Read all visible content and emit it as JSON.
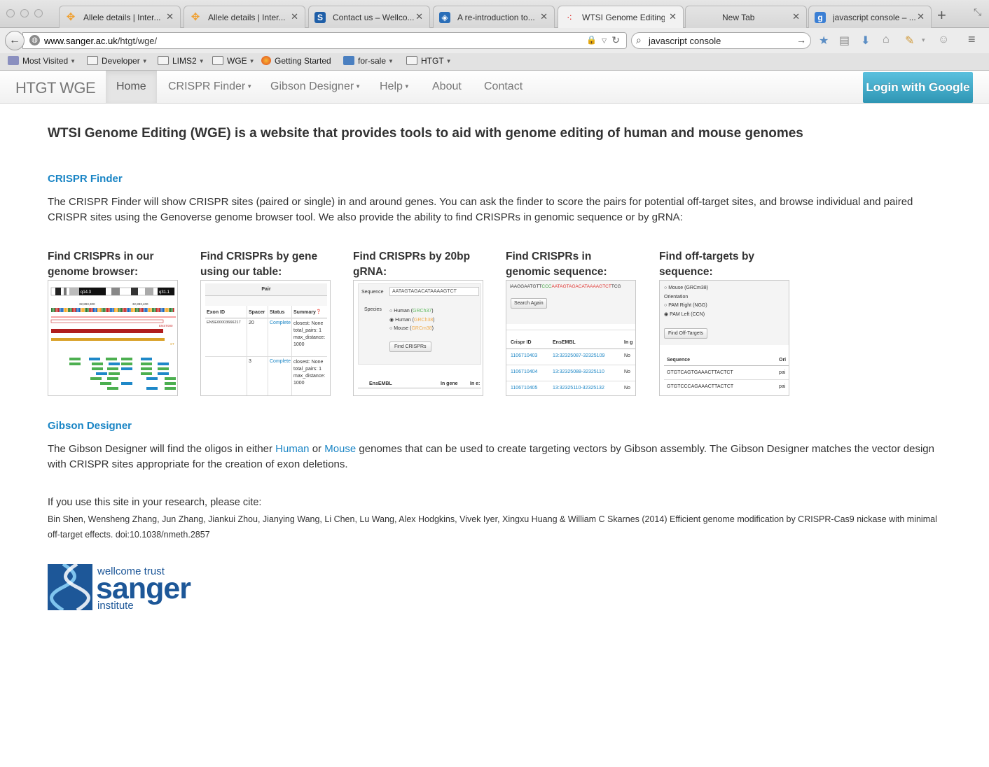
{
  "browser": {
    "tabs": [
      {
        "title": "Allele details | Inter...",
        "icon": "allele-icon",
        "color": "#f0a030"
      },
      {
        "title": "Allele details | Inter...",
        "icon": "allele-icon",
        "color": "#f0a030"
      },
      {
        "title": "Contact us – Wellco...",
        "icon": "wellcome-icon",
        "color": "#1f5fa8"
      },
      {
        "title": "A re-introduction to...",
        "icon": "mdn-icon",
        "color": "#2a6eb8"
      },
      {
        "title": "WTSI Genome Editing",
        "icon": "wge-icon",
        "color": "#e0332f",
        "active": true
      },
      {
        "title": "New Tab",
        "icon": "",
        "color": ""
      },
      {
        "title": "javascript console – ...",
        "icon": "google-icon",
        "color": "#3b7fd4"
      }
    ],
    "url": {
      "domain": "www.sanger.ac.uk",
      "path": "/htgt/wge/"
    },
    "search_value": "javascript console",
    "bookmarks": [
      {
        "label": "Most Visited",
        "dropdown": true
      },
      {
        "label": "Developer",
        "dropdown": true
      },
      {
        "label": "LIMS2",
        "dropdown": true
      },
      {
        "label": "WGE",
        "dropdown": true
      },
      {
        "label": "Getting Started",
        "dropdown": false
      },
      {
        "label": "for-sale",
        "dropdown": true
      },
      {
        "label": "HTGT",
        "dropdown": true
      }
    ]
  },
  "site": {
    "brand": "HTGT WGE",
    "nav": [
      {
        "label": "Home",
        "active": true,
        "dropdown": false
      },
      {
        "label": "CRISPR Finder",
        "dropdown": true
      },
      {
        "label": "Gibson Designer",
        "dropdown": true
      },
      {
        "label": "Help",
        "dropdown": true
      },
      {
        "label": "About",
        "dropdown": false
      },
      {
        "label": "Contact",
        "dropdown": false
      }
    ],
    "login_label": "Login with Google"
  },
  "content": {
    "headline": "WTSI Genome Editing (WGE) is a website that provides tools to aid with genome editing of human and mouse genomes",
    "crispr": {
      "title": "CRISPR Finder",
      "description": "The CRISPR Finder will show CRISPR sites (paired or single) in and around genes. You can ask the finder to score the pairs for potential off-target sites, and browse individual and paired CRISPR sites using the Genoverse genome browser tool. We also provide the ability to find CRISPRs in genomic sequence or by gRNA:",
      "cards": [
        {
          "title": "Find CRISPRs in our genome browser:"
        },
        {
          "title": "Find CRISPRs by gene using our table:"
        },
        {
          "title": "Find CRISPRs by 20bp gRNA:"
        },
        {
          "title": "Find CRISPRs in genomic sequence:"
        },
        {
          "title": "Find off-targets by sequence:"
        }
      ],
      "thumbs": {
        "browser": {
          "band1": "q14.3",
          "band2": "q31.1",
          "coord1": "32,893,300",
          "coord2": "32,893,400",
          "gene": "ENST000",
          "tag": "ST"
        },
        "table": {
          "header": "Pair",
          "cols": [
            "Exon ID",
            "Spacer",
            "Status",
            "Summary"
          ],
          "rows": [
            {
              "exon": "ENSE00003666217",
              "spacer": "20",
              "status": "Complete",
              "summary": [
                "closest: None",
                "total_pairs: 1",
                "max_distance:",
                "1000"
              ]
            },
            {
              "exon": "",
              "spacer": "3",
              "status": "Complete",
              "summary": [
                "closest: None",
                "total_pairs: 1",
                "max_distance:",
                "1000"
              ]
            }
          ]
        },
        "grna": {
          "seq_label": "Sequence",
          "seq_value": "AATAGTAGACATAAAAGTCT",
          "species_label": "Species",
          "species": [
            {
              "name": "Human",
              "build": "GRCh37",
              "checked": false
            },
            {
              "name": "Human",
              "build": "GRCh38",
              "checked": true
            },
            {
              "name": "Mouse",
              "build": "GRCm38",
              "checked": false
            }
          ],
          "button": "Find CRISPRs",
          "footer_cols": [
            "EnsEMBL",
            "In gene",
            "In e:"
          ]
        },
        "genomic": {
          "seq_pre": "iAAGGAATGTT",
          "seq_pam": "CCC",
          "seq_hit": "AATAGTAGACATAAAAGTCT",
          "seq_post": "TCG",
          "button": "Search Again",
          "cols": [
            "Crispr ID",
            "EnsEMBL",
            "In g"
          ],
          "rows": [
            {
              "id": "1106710403",
              "loc": "13:32325087-32325109",
              "in": "No"
            },
            {
              "id": "1106710404",
              "loc": "13:32325088-32325110",
              "in": "No"
            },
            {
              "id": "1106710405",
              "loc": "13:32325110-32325132",
              "in": "No"
            }
          ]
        },
        "offtarget": {
          "species": "Mouse (GRCm38)",
          "orientation_label": "Orientation",
          "options": [
            {
              "label": "PAM Right (NGG)",
              "checked": false
            },
            {
              "label": "PAM Left (CCN)",
              "checked": true
            }
          ],
          "button": "Find Off-Targets",
          "cols": [
            "Sequence",
            "Ori"
          ],
          "rows": [
            {
              "seq": "GTGTCAGTGAAACTTACTCT",
              "ori": "pai"
            },
            {
              "seq": "GTGTCCCAGAAACTTACTCT",
              "ori": "pai"
            }
          ]
        }
      }
    },
    "gibson": {
      "title": "Gibson Designer",
      "text_before": "The Gibson Designer will find the oligos in either ",
      "human_link": "Human",
      "text_mid": " or ",
      "mouse_link": "Mouse",
      "text_after": " genomes that can be used to create targeting vectors by Gibson assembly. The Gibson Designer matches the vector design with CRISPR sites appropriate for the creation of exon deletions."
    },
    "citation": {
      "intro": "If you use this site in your research, please cite:",
      "text": "Bin Shen, Wensheng Zhang, Jun Zhang, Jiankui Zhou, Jianying Wang, Li Chen, Lu Wang, Alex Hodgkins, Vivek Iyer, Xingxu Huang & William C Skarnes (2014) Efficient genome modification by CRISPR-Cas9 nickase with minimal off-target effects. doi:10.1038/nmeth.2857"
    },
    "logo": {
      "line1": "wellcome trust",
      "line2": "sanger",
      "line3": "institute",
      "color": "#1d5798"
    }
  }
}
